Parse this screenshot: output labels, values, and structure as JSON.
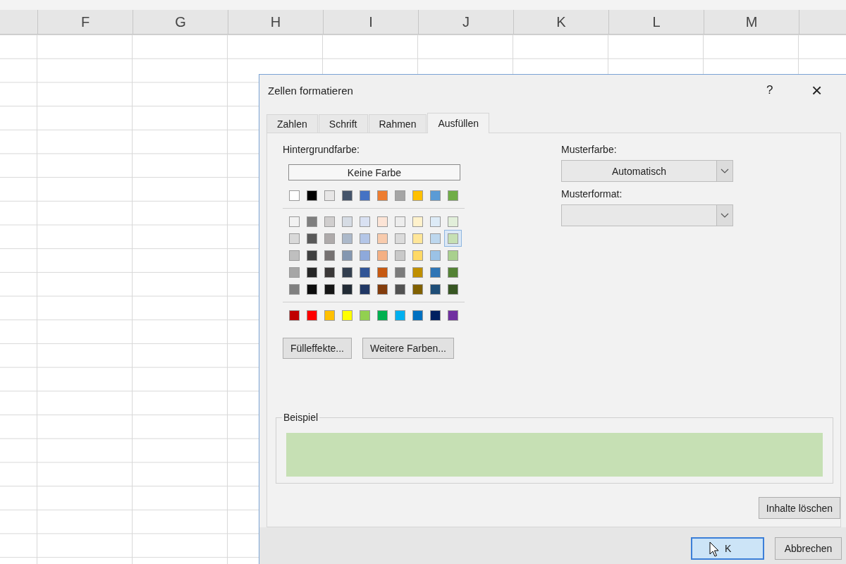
{
  "sheet": {
    "columns": [
      "F",
      "G",
      "H",
      "I",
      "J",
      "K",
      "L",
      "M"
    ]
  },
  "dialog": {
    "title": "Zellen formatieren",
    "help": "?",
    "close": "×",
    "tabs": [
      {
        "label": "Zahlen",
        "selected": false
      },
      {
        "label": "Schrift",
        "selected": false
      },
      {
        "label": "Rahmen",
        "selected": false
      },
      {
        "label": "Ausfüllen",
        "selected": true
      }
    ],
    "background_color": {
      "label": "Hintergrundfarbe:",
      "no_color_button": "Keine Farbe",
      "palette": [
        [
          {
            "color": "#ffffff",
            "selected": false
          },
          {
            "color": "#000000",
            "selected": false
          },
          {
            "color": "#e7e6e6",
            "selected": false
          },
          {
            "color": "#44546a",
            "selected": false
          },
          {
            "color": "#4472c4",
            "selected": false
          },
          {
            "color": "#ed7d31",
            "selected": false
          },
          {
            "color": "#a5a5a5",
            "selected": false
          },
          {
            "color": "#ffc000",
            "selected": false
          },
          {
            "color": "#5b9bd5",
            "selected": false
          },
          {
            "color": "#70ad47",
            "selected": false
          }
        ],
        [
          {
            "color": "#f2f2f2",
            "selected": false
          },
          {
            "color": "#7f7f7f",
            "selected": false
          },
          {
            "color": "#d0cece",
            "selected": false
          },
          {
            "color": "#d6dce4",
            "selected": false
          },
          {
            "color": "#d9e1f2",
            "selected": false
          },
          {
            "color": "#fce4d6",
            "selected": false
          },
          {
            "color": "#ededed",
            "selected": false
          },
          {
            "color": "#fff2cc",
            "selected": false
          },
          {
            "color": "#ddebf7",
            "selected": false
          },
          {
            "color": "#e2efda",
            "selected": false
          }
        ],
        [
          {
            "color": "#d9d9d9",
            "selected": false
          },
          {
            "color": "#595959",
            "selected": false
          },
          {
            "color": "#aeaaaa",
            "selected": false
          },
          {
            "color": "#acb9ca",
            "selected": false
          },
          {
            "color": "#b4c6e7",
            "selected": false
          },
          {
            "color": "#f8cbad",
            "selected": false
          },
          {
            "color": "#dbdbdb",
            "selected": false
          },
          {
            "color": "#ffe699",
            "selected": false
          },
          {
            "color": "#bdd7ee",
            "selected": false
          },
          {
            "color": "#c6e0b4",
            "selected": true
          }
        ],
        [
          {
            "color": "#bfbfbf",
            "selected": false
          },
          {
            "color": "#404040",
            "selected": false
          },
          {
            "color": "#757171",
            "selected": false
          },
          {
            "color": "#8497b0",
            "selected": false
          },
          {
            "color": "#8ea9db",
            "selected": false
          },
          {
            "color": "#f4b084",
            "selected": false
          },
          {
            "color": "#c9c9c9",
            "selected": false
          },
          {
            "color": "#ffd966",
            "selected": false
          },
          {
            "color": "#9bc2e6",
            "selected": false
          },
          {
            "color": "#a9d08e",
            "selected": false
          }
        ],
        [
          {
            "color": "#a6a6a6",
            "selected": false
          },
          {
            "color": "#262626",
            "selected": false
          },
          {
            "color": "#3a3838",
            "selected": false
          },
          {
            "color": "#333f4f",
            "selected": false
          },
          {
            "color": "#305496",
            "selected": false
          },
          {
            "color": "#c65911",
            "selected": false
          },
          {
            "color": "#7b7b7b",
            "selected": false
          },
          {
            "color": "#bf8f00",
            "selected": false
          },
          {
            "color": "#2f75b5",
            "selected": false
          },
          {
            "color": "#548235",
            "selected": false
          }
        ],
        [
          {
            "color": "#808080",
            "selected": false
          },
          {
            "color": "#0d0d0d",
            "selected": false
          },
          {
            "color": "#161616",
            "selected": false
          },
          {
            "color": "#222b35",
            "selected": false
          },
          {
            "color": "#203764",
            "selected": false
          },
          {
            "color": "#833c0c",
            "selected": false
          },
          {
            "color": "#525252",
            "selected": false
          },
          {
            "color": "#806000",
            "selected": false
          },
          {
            "color": "#1f4e78",
            "selected": false
          },
          {
            "color": "#375623",
            "selected": false
          }
        ],
        [
          {
            "color": "#c00000",
            "selected": false
          },
          {
            "color": "#ff0000",
            "selected": false
          },
          {
            "color": "#ffc000",
            "selected": false
          },
          {
            "color": "#ffff00",
            "selected": false
          },
          {
            "color": "#92d050",
            "selected": false
          },
          {
            "color": "#00b050",
            "selected": false
          },
          {
            "color": "#00b0f0",
            "selected": false
          },
          {
            "color": "#0070c0",
            "selected": false
          },
          {
            "color": "#002060",
            "selected": false
          },
          {
            "color": "#7030a0",
            "selected": false
          }
        ]
      ],
      "buttons": [
        "Fülleffekte...",
        "Weitere Farben..."
      ]
    },
    "pattern_color": {
      "label": "Musterfarbe:",
      "value": "Automatisch"
    },
    "pattern_style": {
      "label": "Musterformat:"
    },
    "sample": {
      "label": "Beispiel"
    },
    "clear_button": "Inhalte löschen",
    "footer_buttons": [
      {
        "label": "K",
        "focused": true
      },
      {
        "label": "Abbrechen",
        "focused": false
      }
    ]
  }
}
